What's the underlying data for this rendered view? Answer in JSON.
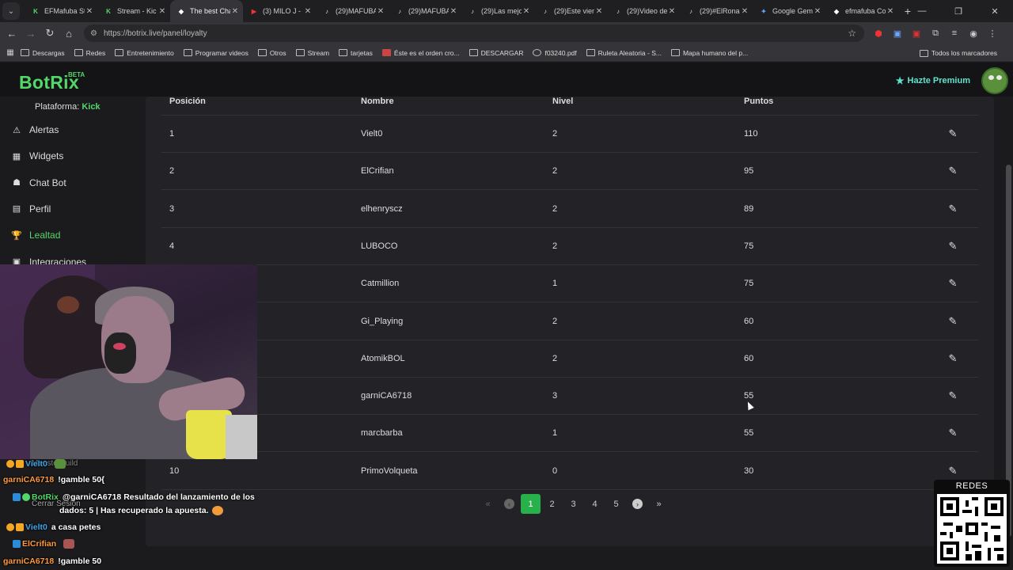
{
  "browser": {
    "tabs": [
      {
        "title": "EFMafuba St",
        "fav": "K",
        "fav_color": "#53d769",
        "active": false
      },
      {
        "title": "Stream - Kic",
        "fav": "K",
        "fav_color": "#53d769",
        "active": false
      },
      {
        "title": "The best Cha",
        "fav": "◆",
        "fav_color": "#ffffff",
        "active": true
      },
      {
        "title": "(3) MILO J -",
        "fav": "▶",
        "fav_color": "#e33",
        "active": false
      },
      {
        "title": "(29)MAFUBA",
        "fav": "♪",
        "fav_color": "#ddd",
        "active": false
      },
      {
        "title": "(29)MAFUBA",
        "fav": "♪",
        "fav_color": "#ddd",
        "active": false
      },
      {
        "title": "(29)Las mejo",
        "fav": "♪",
        "fav_color": "#ddd",
        "active": false
      },
      {
        "title": "(29)Este vien",
        "fav": "♪",
        "fav_color": "#ddd",
        "active": false
      },
      {
        "title": "(29)Video de",
        "fav": "♪",
        "fav_color": "#ddd",
        "active": false
      },
      {
        "title": "(29)#ElRona",
        "fav": "♪",
        "fav_color": "#ddd",
        "active": false
      },
      {
        "title": "Google Gem",
        "fav": "✦",
        "fav_color": "#6aa6ff",
        "active": false
      },
      {
        "title": "efmafuba Co",
        "fav": "◆",
        "fav_color": "#ffffff",
        "active": false
      }
    ],
    "url": "https://botrix.live/panel/loyalty",
    "bookmarks": [
      "Descargas",
      "Redes",
      "Entretenimiento",
      "Programar videos",
      "Otros",
      "Stream",
      "tarjetas",
      "Éste es el orden cro...",
      "DESCARGAR",
      "f03240.pdf",
      "Ruleta Aleatoria - S...",
      "Mapa humano del p..."
    ],
    "all_bookmarks": "Todos los marcadores"
  },
  "app": {
    "logo": "BotRix",
    "beta": "BETA",
    "premium": "Hazte Premium",
    "platform_label": "Plataforma:",
    "platform_value": "Kick",
    "nav": [
      {
        "label": "Alertas",
        "icon": "⚠",
        "active": false
      },
      {
        "label": "Widgets",
        "icon": "▦",
        "active": false
      },
      {
        "label": "Chat Bot",
        "icon": "☗",
        "active": false
      },
      {
        "label": "Perfil",
        "icon": "▤",
        "active": false
      },
      {
        "label": "Lealtad",
        "icon": "🏆",
        "active": true
      },
      {
        "label": "Integraciones",
        "icon": "▣",
        "active": false
      }
    ],
    "table": {
      "headers": [
        "Posición",
        "Nombre",
        "Nivel",
        "Puntos"
      ],
      "rows": [
        {
          "pos": "1",
          "name": "Vielt0",
          "level": "2",
          "points": "110"
        },
        {
          "pos": "2",
          "name": "ElCrifian",
          "level": "2",
          "points": "95"
        },
        {
          "pos": "3",
          "name": "elhenryscz",
          "level": "2",
          "points": "89"
        },
        {
          "pos": "4",
          "name": "LUBOCO",
          "level": "2",
          "points": "75"
        },
        {
          "pos": "",
          "name": "Catmillion",
          "level": "1",
          "points": "75"
        },
        {
          "pos": "",
          "name": "Gi_Playing",
          "level": "2",
          "points": "60"
        },
        {
          "pos": "",
          "name": "AtomikBOL",
          "level": "2",
          "points": "60"
        },
        {
          "pos": "",
          "name": "garniCA6718",
          "level": "3",
          "points": "55"
        },
        {
          "pos": "",
          "name": "marcbarba",
          "level": "1",
          "points": "55"
        },
        {
          "pos": "10",
          "name": "PrimoVolqueta",
          "level": "0",
          "points": "30"
        }
      ]
    },
    "pagination": {
      "pages": [
        "1",
        "2",
        "3",
        "4",
        "5"
      ],
      "current": "1"
    }
  },
  "overlay": {
    "chat": [
      {
        "user": "Vielt0",
        "msg": "",
        "color": "blue"
      },
      {
        "user": "garniCA6718",
        "msg": "!gamble 50{",
        "color": "orange"
      },
      {
        "user": "BotRix",
        "msg": "@garniCA6718 Resultado del lanzamiento de los",
        "color": "green"
      },
      {
        "user": "",
        "msg": "dados: 5 | Has recuperado la apuesta.",
        "color": "green"
      },
      {
        "user": "Vielt0",
        "msg": "a casa petes",
        "color": "blue"
      },
      {
        "user": "ElCrifian",
        "msg": "",
        "color": "orange"
      },
      {
        "user": "garniCA6718",
        "msg": "!gamble 50",
        "color": "orange"
      }
    ],
    "behind_chat": [
      "MonsterBuild",
      "Cerrar Sesion"
    ],
    "qr_title": "REDES"
  }
}
